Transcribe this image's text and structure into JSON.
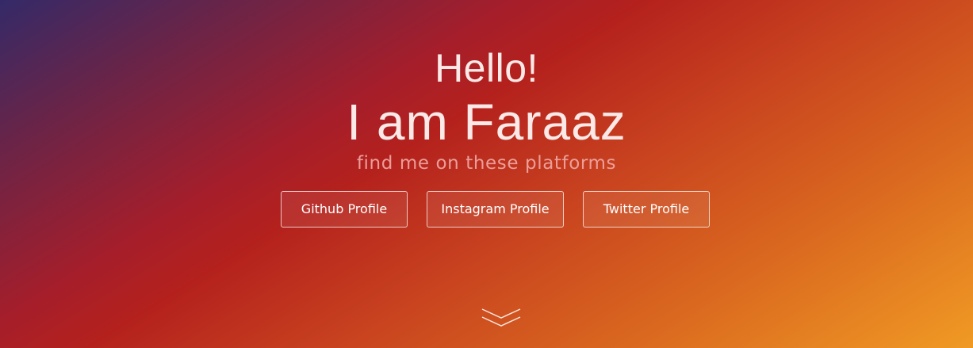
{
  "hero": {
    "greeting": "Hello!",
    "name": "I am Faraaz",
    "tagline": "find me on these platforms"
  },
  "profiles": [
    {
      "label": "Github Profile"
    },
    {
      "label": "Instagram Profile"
    },
    {
      "label": "Twitter Profile"
    }
  ],
  "scroll_indicator": {
    "icon": "double-chevron-down-icon"
  },
  "colors": {
    "gradient_start": "#342a68",
    "gradient_mid": "#b4211d",
    "gradient_end": "#f09a24",
    "text": "#ffffff"
  }
}
